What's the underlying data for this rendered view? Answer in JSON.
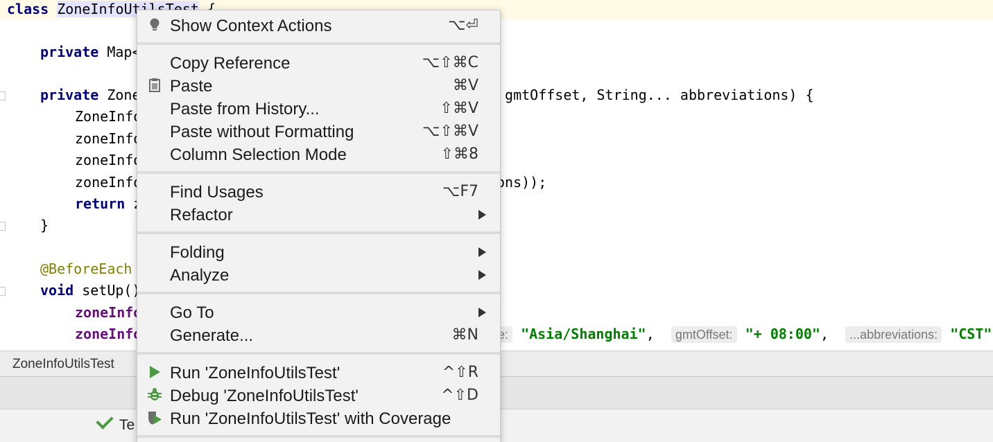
{
  "editor": {
    "lines": {
      "l1_kw": "class",
      "l1_name": "ZoneInfoUtilsTest",
      "l1_rest": " {",
      "l2_kw": "private",
      "l2_rest": " Map<",
      "l3_kw": "private",
      "l3_start": " Zone",
      "l3_end": " gmtOffset, String... abbreviations) {",
      "l4": "ZoneInfo",
      "l5": "zoneInfo",
      "l6": "zoneInfo",
      "l7_start": "zoneInfo",
      "l7_end": "ons));",
      "l8_kw": "return",
      "l8_rest": " z",
      "l9": "}",
      "l10": "@BeforeEach",
      "l11_kw": "void",
      "l11_rest": " setUp()",
      "l12": "zoneInfo",
      "l13": "zoneInfo",
      "l13_hint1": "e:",
      "l13_str1": "\"Asia/Shanghai\"",
      "l13_comma1": ", ",
      "l13_hint2": "gmtOffset:",
      "l13_str2": "\"+ 08:00\"",
      "l13_comma2": ", ",
      "l13_hint3": "...abbreviations:",
      "l13_str3": "\"CST\""
    }
  },
  "tool_window": {
    "title": "ZoneInfoUtilsTest",
    "status": "Te"
  },
  "menu": {
    "groups": [
      [
        {
          "label": "Show Context Actions",
          "shortcut": "⌥⏎",
          "icon": "bulb-icon"
        }
      ],
      [
        {
          "label": "Copy Reference",
          "shortcut": "⌥⇧⌘C"
        },
        {
          "label": "Paste",
          "shortcut": "⌘V",
          "icon": "clipboard-icon"
        },
        {
          "label": "Paste from History...",
          "shortcut": "⇧⌘V"
        },
        {
          "label": "Paste without Formatting",
          "shortcut": "⌥⇧⌘V"
        },
        {
          "label": "Column Selection Mode",
          "shortcut": "⇧⌘8"
        }
      ],
      [
        {
          "label": "Find Usages",
          "shortcut": "⌥F7"
        },
        {
          "label": "Refactor",
          "submenu": true
        }
      ],
      [
        {
          "label": "Folding",
          "submenu": true
        },
        {
          "label": "Analyze",
          "submenu": true
        }
      ],
      [
        {
          "label": "Go To",
          "submenu": true
        },
        {
          "label": "Generate...",
          "shortcut": "⌘N"
        }
      ],
      [
        {
          "label": "Run 'ZoneInfoUtilsTest'",
          "shortcut": "^⇧R",
          "icon": "run-icon"
        },
        {
          "label": "Debug 'ZoneInfoUtilsTest'",
          "shortcut": "^⇧D",
          "icon": "debug-icon"
        },
        {
          "label": "Run 'ZoneInfoUtilsTest' with Coverage",
          "icon": "coverage-icon"
        }
      ]
    ]
  },
  "colors": {
    "keyword": "#000080",
    "string": "#008000",
    "field": "#660e7a",
    "annotation": "#808000",
    "run_green": "#4b9a42"
  }
}
